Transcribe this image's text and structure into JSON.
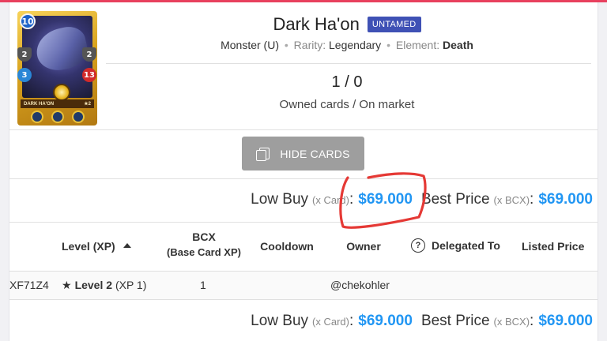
{
  "card": {
    "mana": "10",
    "stat_left": "2",
    "stat_magic": "3",
    "stat_right": "2",
    "stat_health": "13",
    "banner_name": "DARK HA'ON",
    "banner_level": "★2"
  },
  "title": "Dark Ha'on",
  "badge": "UNTAMED",
  "meta": {
    "type": "Monster (U)",
    "rarity_label": "Rarity:",
    "rarity_value": "Legendary",
    "element_label": "Element:",
    "element_value": "Death",
    "separator": "•"
  },
  "counts": {
    "value": "1 / 0",
    "label": "Owned cards / On market"
  },
  "hide_button": {
    "label": "HIDE CARDS",
    "icon": "cards-icon"
  },
  "prices": {
    "low_buy_label": "Low Buy",
    "low_buy_unit": "(x Card)",
    "colon": ":",
    "low_buy_value": "$69.000",
    "best_price_label": "Best Price",
    "best_price_unit": "(x BCX)",
    "best_price_value": "$69.000"
  },
  "table": {
    "headers": {
      "level": "Level (XP)",
      "bcx": "BCX",
      "bcx_sub": "(Base Card XP)",
      "cooldown": "Cooldown",
      "owner": "Owner",
      "delegated": "Delegated To",
      "listed": "Listed Price"
    },
    "row": {
      "id": "XF71Z4",
      "level_label": "Level 2",
      "xp": "(XP 1)",
      "bcx": "1",
      "owner": "@chekohler"
    }
  },
  "colors": {
    "accent_blue": "#2196f3",
    "badge": "#3f51b5",
    "button": "#9e9e9e",
    "annotation": "#e53935",
    "top_strip": "#e8405e"
  }
}
